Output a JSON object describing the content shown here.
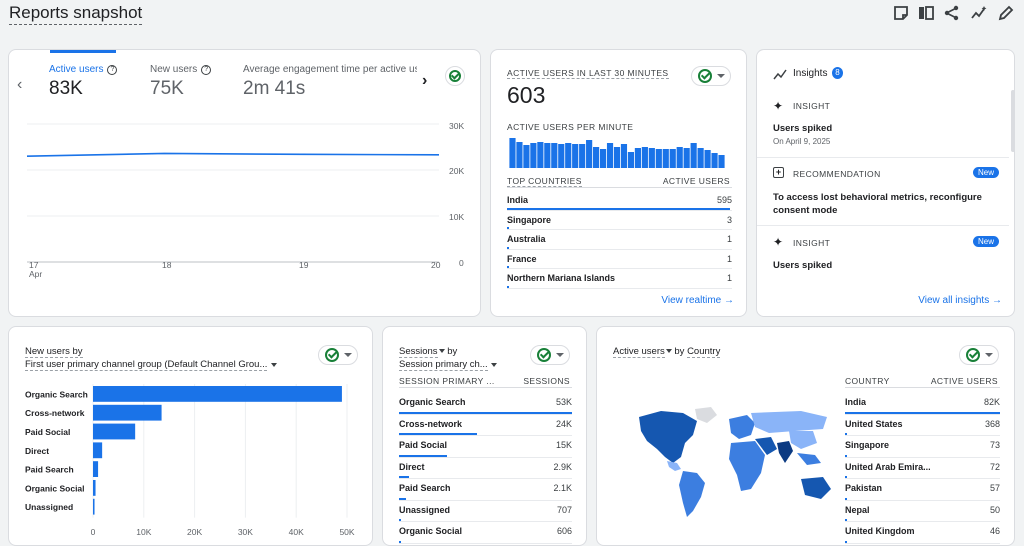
{
  "header": {
    "title": "Reports snapshot"
  },
  "overview": {
    "metrics": [
      {
        "label": "Active users",
        "value": "83K"
      },
      {
        "label": "New users",
        "value": "75K"
      },
      {
        "label": "Average engagement time per active us",
        "value": "2m 41s"
      }
    ],
    "yticks": [
      "30K",
      "20K",
      "10K",
      "0"
    ],
    "xticks": [
      "17",
      "18",
      "19",
      "20"
    ],
    "xmonth": "Apr"
  },
  "realtime": {
    "title": "ACTIVE USERS IN LAST 30 MINUTES",
    "value": "603",
    "per_minute_label": "ACTIVE USERS PER MINUTE",
    "col_country": "TOP COUNTRIES",
    "col_users": "ACTIVE USERS",
    "rows": [
      {
        "name": "India",
        "value": "595",
        "fraction": 0.99
      },
      {
        "name": "Singapore",
        "value": "3",
        "fraction": 0.005
      },
      {
        "name": "Australia",
        "value": "1",
        "fraction": 0.002
      },
      {
        "name": "France",
        "value": "1",
        "fraction": 0.002
      },
      {
        "name": "Northern Mariana Islands",
        "value": "1",
        "fraction": 0.002
      }
    ],
    "link": "View realtime"
  },
  "insights": {
    "title": "Insights",
    "count": "8",
    "items": [
      {
        "type": "INSIGHT",
        "title": "Users spiked",
        "sub": "On April 9, 2025",
        "badge": ""
      },
      {
        "type": "RECOMMENDATION",
        "title": "To access lost behavioral metrics, reconfigure consent mode",
        "sub": "",
        "badge": "New"
      },
      {
        "type": "INSIGHT",
        "title": "Users spiked",
        "sub": "",
        "badge": "New"
      }
    ],
    "link": "View all insights"
  },
  "newusers": {
    "title": "New users by",
    "subtitle": "First user primary channel group (Default Channel Grou...",
    "xticks": [
      "0",
      "10K",
      "20K",
      "30K",
      "40K",
      "50K"
    ]
  },
  "sessions": {
    "title_a": "Sessions",
    "title_b": " by",
    "subtitle": "Session primary ch...",
    "col_a": "SESSION PRIMARY ...",
    "col_b": "SESSIONS",
    "rows": [
      {
        "name": "Organic Search",
        "value": "53K",
        "fraction": 1.0
      },
      {
        "name": "Cross-network",
        "value": "24K",
        "fraction": 0.45
      },
      {
        "name": "Paid Social",
        "value": "15K",
        "fraction": 0.28
      },
      {
        "name": "Direct",
        "value": "2.9K",
        "fraction": 0.055
      },
      {
        "name": "Paid Search",
        "value": "2.1K",
        "fraction": 0.04
      },
      {
        "name": "Unassigned",
        "value": "707",
        "fraction": 0.013
      },
      {
        "name": "Organic Social",
        "value": "606",
        "fraction": 0.011
      }
    ]
  },
  "country": {
    "title_a": "Active users",
    "title_b": " by ",
    "title_c": "Country",
    "col_a": "COUNTRY",
    "col_b": "ACTIVE USERS",
    "rows": [
      {
        "name": "India",
        "value": "82K",
        "fraction": 1.0
      },
      {
        "name": "United States",
        "value": "368",
        "fraction": 0.0045
      },
      {
        "name": "Singapore",
        "value": "73",
        "fraction": 0.001
      },
      {
        "name": "United Arab Emira...",
        "value": "72",
        "fraction": 0.001
      },
      {
        "name": "Pakistan",
        "value": "57",
        "fraction": 0.001
      },
      {
        "name": "Nepal",
        "value": "50",
        "fraction": 0.001
      },
      {
        "name": "United Kingdom",
        "value": "46",
        "fraction": 0.001
      }
    ]
  },
  "chart_data": [
    {
      "type": "line",
      "x": [
        "17 Apr",
        "18 Apr",
        "19 Apr",
        "20 Apr"
      ],
      "series": [
        {
          "name": "Active users",
          "values": [
            23000,
            23600,
            23400,
            23300
          ]
        }
      ],
      "ylim": [
        0,
        30000
      ]
    },
    {
      "type": "bar",
      "categories": [
        "Organic Search",
        "Cross-network",
        "Paid Social",
        "Direct",
        "Paid Search",
        "Organic Social",
        "Unassigned"
      ],
      "values": [
        49000,
        13500,
        8300,
        1800,
        1000,
        500,
        300
      ],
      "xlim": [
        0,
        50000
      ]
    },
    {
      "type": "bar",
      "values": [
        30,
        26,
        23,
        25,
        26,
        25,
        25,
        24,
        25,
        24,
        24,
        28,
        21,
        19,
        25,
        21,
        24,
        16,
        20,
        21,
        20,
        19,
        19,
        19,
        21,
        20,
        25,
        20,
        18,
        15,
        13
      ]
    }
  ],
  "colors": {
    "accent": "#1a73e8",
    "bar": "#1a73e8",
    "map_dark": "#1557b0",
    "map_mid": "#3c7ee0",
    "map_light": "#8ab4f8",
    "map_none": "#dadce0"
  }
}
